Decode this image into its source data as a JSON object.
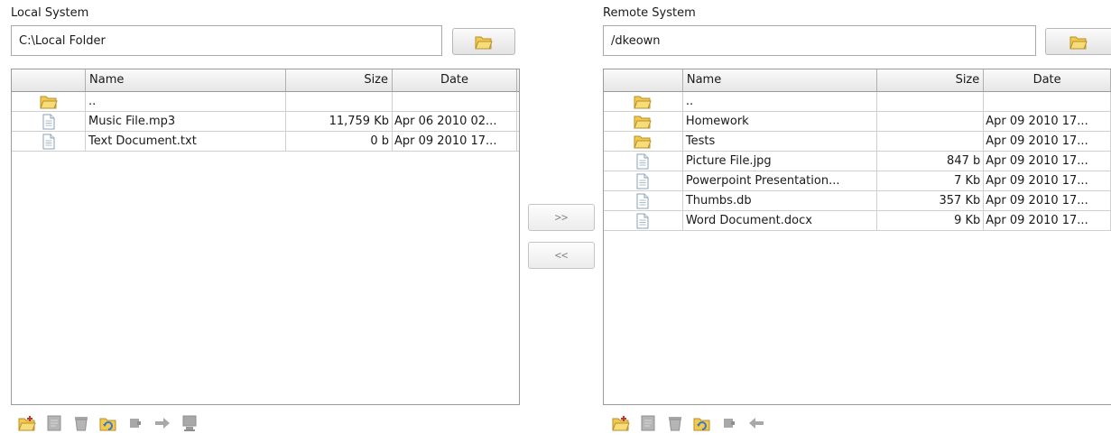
{
  "local": {
    "label": "Local System",
    "path": "C:\\Local Folder",
    "columns": {
      "name": "Name",
      "size": "Size",
      "date": "Date"
    },
    "rows": [
      {
        "icon": "folder-icon",
        "name": "..",
        "size": "",
        "date": ""
      },
      {
        "icon": "file-icon",
        "name": "Music File.mp3",
        "size": "11,759 Kb",
        "date": "Apr 06 2010 02..."
      },
      {
        "icon": "file-icon",
        "name": "Text Document.txt",
        "size": "0 b",
        "date": "Apr 09 2010 17..."
      }
    ]
  },
  "remote": {
    "label": "Remote System",
    "path": "/dkeown",
    "columns": {
      "name": "Name",
      "size": "Size",
      "date": "Date"
    },
    "rows": [
      {
        "icon": "folder-icon",
        "name": "..",
        "size": "",
        "date": ""
      },
      {
        "icon": "folder-icon",
        "name": "Homework",
        "size": "",
        "date": "Apr 09 2010 17..."
      },
      {
        "icon": "folder-icon",
        "name": "Tests",
        "size": "",
        "date": "Apr 09 2010 17..."
      },
      {
        "icon": "file-icon",
        "name": "Picture File.jpg",
        "size": "847 b",
        "date": "Apr 09 2010 17..."
      },
      {
        "icon": "file-icon",
        "name": "Powerpoint Presentation...",
        "size": "7 Kb",
        "date": "Apr 09 2010 17..."
      },
      {
        "icon": "file-icon",
        "name": "Thumbs.db",
        "size": "357 Kb",
        "date": "Apr 09 2010 17..."
      },
      {
        "icon": "file-icon",
        "name": "Word Document.docx",
        "size": "9 Kb",
        "date": "Apr 09 2010 17..."
      }
    ]
  },
  "transfer": {
    "upload_label": ">>",
    "download_label": "<<"
  },
  "toolbars": {
    "local": [
      "new-folder-icon",
      "rename-icon",
      "delete-icon",
      "refresh-icon",
      "properties-icon",
      "upload-arrow-icon",
      "transfer-computer-icon"
    ],
    "remote": [
      "new-folder-icon",
      "rename-icon",
      "delete-icon",
      "refresh-icon",
      "properties-icon",
      "download-arrow-icon"
    ]
  },
  "colors": {
    "folder": "#f2c94c",
    "folder_stroke": "#b8902a",
    "icon_gray": "#9a9a9a",
    "refresh_blue": "#3a78c9"
  }
}
